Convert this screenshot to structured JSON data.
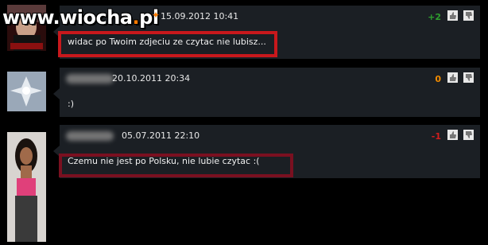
{
  "site": {
    "watermark_prefix": "www.",
    "watermark_name": "wiocha",
    "watermark_tld": "pl",
    "dot_color": "#ff7a00"
  },
  "comments": [
    {
      "date": "15.09.2012 10:41",
      "score": "+2",
      "score_color": "#2e9e2e",
      "text": "widac po Twoim zdjeciu ze czytac nie lubisz..."
    },
    {
      "date": "20.10.2011 20:34",
      "score": "0",
      "score_color": "#f08a00",
      "text": ":)"
    },
    {
      "date": "05.07.2011 22:10",
      "score": "-1",
      "score_color": "#d21e1e",
      "text": "Czemu nie jest po Polsku, nie lubie czytac :("
    }
  ],
  "icons": {
    "vote_up": "thumbs-up-icon",
    "vote_down": "thumbs-down-icon"
  },
  "highlight_color": "#c8181c"
}
